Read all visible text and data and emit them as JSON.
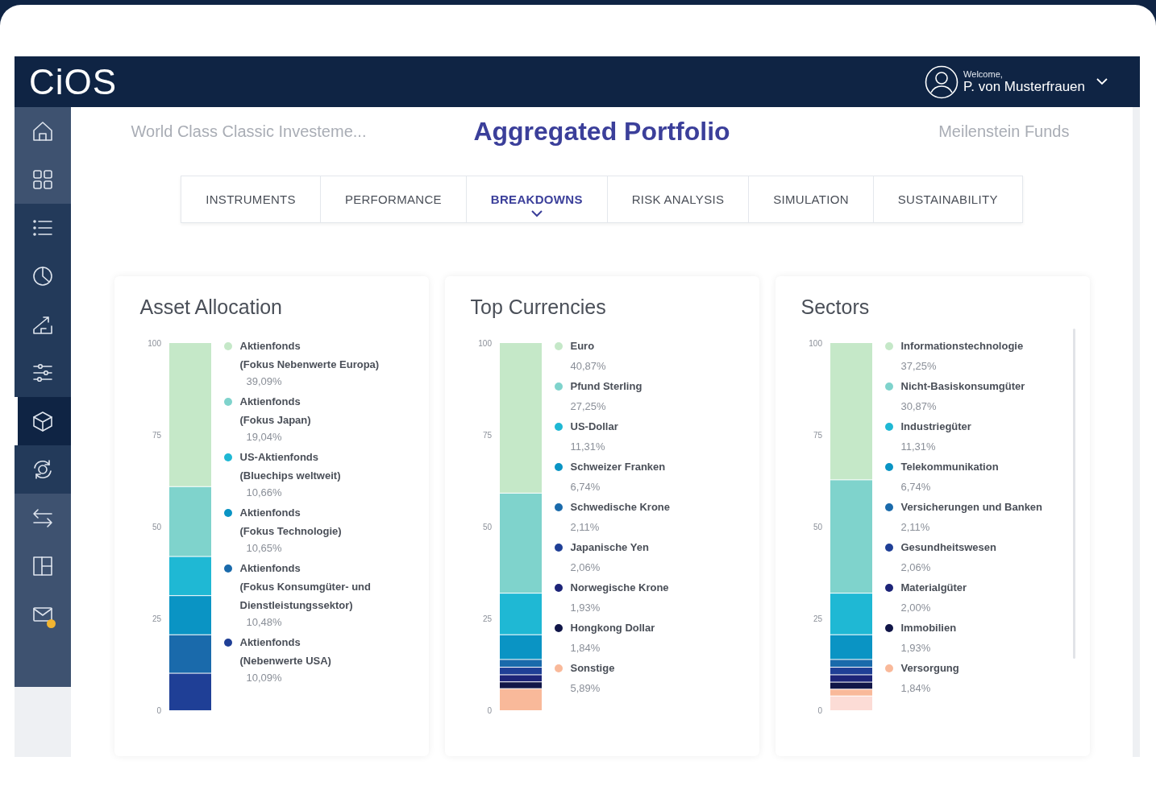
{
  "header": {
    "logo": "CiOS",
    "welcome": "Welcome,",
    "user": "P. von Musterfrauen"
  },
  "sidebar": {
    "items": [
      {
        "kind": "light",
        "selected": false,
        "notification": false
      },
      {
        "kind": "light",
        "selected": false,
        "notification": false
      },
      {
        "kind": "dark",
        "selected": false,
        "notification": false
      },
      {
        "kind": "dark",
        "selected": false,
        "notification": false
      },
      {
        "kind": "dark",
        "selected": false,
        "notification": false
      },
      {
        "kind": "dark",
        "selected": false,
        "notification": false
      },
      {
        "kind": "dark",
        "selected": true,
        "notification": false
      },
      {
        "kind": "dark",
        "selected": false,
        "notification": false
      },
      {
        "kind": "light",
        "selected": false,
        "notification": false
      },
      {
        "kind": "light",
        "selected": false,
        "notification": false
      },
      {
        "kind": "light",
        "selected": false,
        "notification": true
      }
    ]
  },
  "page": {
    "left": "World Class Classic Investeme...",
    "title": "Aggregated Portfolio",
    "right": "Meilenstein Funds"
  },
  "tabs": [
    {
      "label": "INSTRUMENTS",
      "selected": false
    },
    {
      "label": "PERFORMANCE",
      "selected": false
    },
    {
      "label": "BREAKDOWNS",
      "selected": true
    },
    {
      "label": "RISK ANALYSIS",
      "selected": false
    },
    {
      "label": "SIMULATION",
      "selected": false
    },
    {
      "label": "SUSTAINABILITY",
      "selected": false
    }
  ],
  "cards": [
    {
      "title": "Asset Allocation",
      "scrollable": false,
      "percentages": [
        "39,09%",
        "19,04%",
        "10,66%",
        "10,65%",
        "10,48%",
        "10,09%"
      ],
      "chart_data": {
        "type": "bar",
        "stacked": true,
        "legend": "right",
        "categories": [
          null
        ],
        "ylim": [
          0,
          100
        ],
        "yticks": [
          0,
          25,
          50,
          75,
          100
        ],
        "series": [
          {
            "name": "Aktienfonds\n(Fokus Nebenwerte Europa)",
            "color": "#c5e8c8",
            "values": [
              39.09
            ]
          },
          {
            "name": "Aktienfonds\n(Fokus Japan)",
            "color": "#7fd3cc",
            "values": [
              19.04
            ]
          },
          {
            "name": "US-Aktienfonds\n(Bluechips weltweit)",
            "color": "#1fb8d4",
            "values": [
              10.66
            ]
          },
          {
            "name": "Aktienfonds\n(Fokus Technologie)",
            "color": "#0a94c4",
            "values": [
              10.65
            ]
          },
          {
            "name": "Aktienfonds\n(Fokus Konsumgüter- und\nDienstleistungssektor)",
            "color": "#1a6aab",
            "values": [
              10.48
            ]
          },
          {
            "name": "Aktienfonds\n(Nebenwerte USA)",
            "color": "#1f3f96",
            "values": [
              10.09
            ]
          }
        ]
      }
    },
    {
      "title": "Top Currencies",
      "scrollable": false,
      "percentages": [
        "40,87%",
        "27,25%",
        "11,31%",
        "6,74%",
        "2,11%",
        "2,06%",
        "1,93%",
        "1,84%",
        "5,89%"
      ],
      "chart_data": {
        "type": "bar",
        "stacked": true,
        "legend": "right",
        "categories": [
          null
        ],
        "ylim": [
          0,
          100
        ],
        "yticks": [
          0,
          25,
          50,
          75,
          100
        ],
        "series": [
          {
            "name": "Euro",
            "color": "#c5e8c8",
            "values": [
              40.87
            ]
          },
          {
            "name": "Pfund Sterling",
            "color": "#7fd3cc",
            "values": [
              27.25
            ]
          },
          {
            "name": "US-Dollar",
            "color": "#1fb8d4",
            "values": [
              11.31
            ]
          },
          {
            "name": "Schweizer Franken",
            "color": "#0a94c4",
            "values": [
              6.74
            ]
          },
          {
            "name": "Schwedische Krone",
            "color": "#1a6aab",
            "values": [
              2.11
            ]
          },
          {
            "name": "Japanische Yen",
            "color": "#1f3f96",
            "values": [
              2.06
            ]
          },
          {
            "name": "Norwegische Krone",
            "color": "#1d2478",
            "values": [
              1.93
            ]
          },
          {
            "name": "Hongkong Dollar",
            "color": "#111648",
            "values": [
              1.84
            ]
          },
          {
            "name": "Sonstige",
            "color": "#f9b99a",
            "values": [
              5.89
            ]
          }
        ]
      }
    },
    {
      "title": "Sectors",
      "scrollable": true,
      "percentages": [
        "37,25%",
        "30,87%",
        "11,31%",
        "6,74%",
        "2,11%",
        "2,06%",
        "2,00%",
        "1,93%",
        "1,84%"
      ],
      "chart_data": {
        "type": "bar",
        "stacked": true,
        "legend": "right",
        "categories": [
          null
        ],
        "ylim": [
          0,
          100
        ],
        "yticks": [
          0,
          25,
          50,
          75,
          100
        ],
        "series": [
          {
            "name": "Informationstechnologie",
            "color": "#c5e8c8",
            "values": [
              37.25
            ]
          },
          {
            "name": "Nicht-Basiskonsumgüter",
            "color": "#7fd3cc",
            "values": [
              30.87
            ]
          },
          {
            "name": "Industriegüter",
            "color": "#1fb8d4",
            "values": [
              11.31
            ]
          },
          {
            "name": "Telekommunikation",
            "color": "#0a94c4",
            "values": [
              6.74
            ]
          },
          {
            "name": "Versicherungen und Banken",
            "color": "#1a6aab",
            "values": [
              2.11
            ]
          },
          {
            "name": "Gesundheitswesen",
            "color": "#1f3f96",
            "values": [
              2.06
            ]
          },
          {
            "name": "Materialgüter",
            "color": "#1d2478",
            "values": [
              2.0
            ]
          },
          {
            "name": "Immobilien",
            "color": "#111648",
            "values": [
              1.93
            ]
          },
          {
            "name": "Versorgung",
            "color": "#f9b99a",
            "values": [
              1.84
            ]
          },
          {
            "color": "#fcdcd6",
            "values": [
              3.89
            ]
          }
        ]
      }
    }
  ]
}
